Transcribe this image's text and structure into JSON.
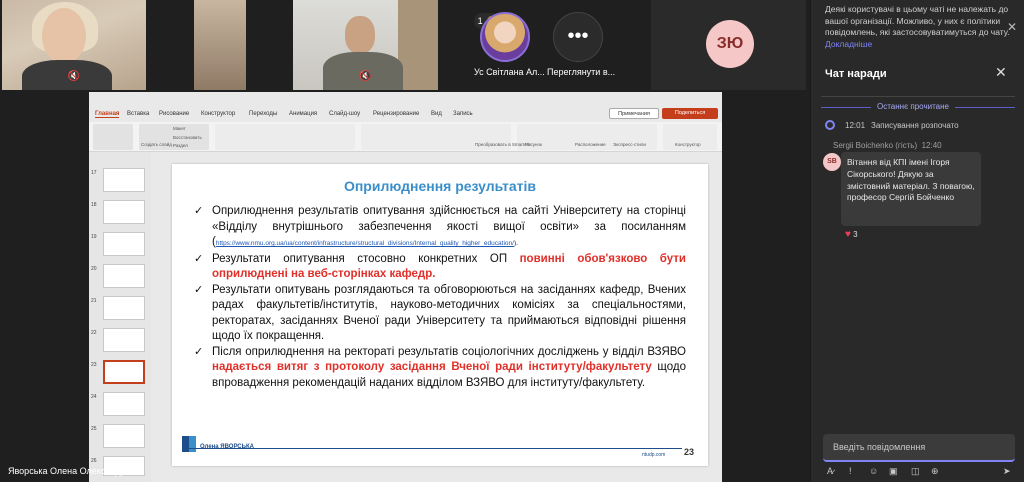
{
  "participants": [
    {
      "name": "",
      "tile": "video"
    },
    {
      "name": "",
      "tile": "video"
    },
    {
      "name": "",
      "tile": "video"
    },
    {
      "name": "Ус Світлана Ал...",
      "tile": "avatar",
      "hand_count": "1"
    },
    {
      "name": "Переглянути в...",
      "tile": "more"
    },
    {
      "name": "",
      "tile": "initials",
      "initials": "ЗЮ"
    }
  ],
  "presenter_name": "Яворська Олена Олександрівна",
  "ppt": {
    "menu": [
      "Главная",
      "Вставка",
      "Рисование",
      "Конструктор",
      "Переходы",
      "Анимация",
      "Слайд-шоу",
      "Рецензирование",
      "Вид",
      "Запись"
    ],
    "notes_button": "Примечания",
    "share_button": "Поделиться",
    "ribbon_labels": [
      "Создать слайд",
      "Макет",
      "Восстановить",
      "Раздел",
      "Преобразовать в SmartArt",
      "Рисунок",
      "Расположение",
      "Экспресс-стили",
      "Конструктор"
    ],
    "thumb_numbers": [
      "17",
      "18",
      "19",
      "20",
      "21",
      "22",
      "23",
      "24",
      "25",
      "26"
    ],
    "selected_thumb": "23"
  },
  "slide": {
    "title": "Оприлюднення результатів",
    "b1_text": "Оприлюднення результатів опитування здійснюється на сайті Університету на сторінці «Відділу внутрішнього забезпечення якості вищої освіти» за посиланням (",
    "b1_link": "https://www.nmu.org.ua/ua/content/infrastructure/structural_divisions/Internal_quality_higher_education/",
    "b1_end": ").",
    "b2_text": "Результати опитування стосовно конкретних ОП ",
    "b2_red": "повинні обов'язково бути оприлюднені на веб-сторінках кафедр.",
    "b3_text": "Результати опитувань розглядаються та обговорюються на засіданнях кафедр, Вчених радах факультетів/інститутів, науково-методичних комісіях за спеціальностями, ректоратах, засіданнях Вченої ради Університету та приймаються відповідні рішення щодо їх покращення.",
    "b4_text": "Після оприлюднення на ректораті результатів соціологічних досліджень у відділ ВЗЯВО ",
    "b4_red": "надається витяг з протоколу засідання Вченої ради інституту/факультету",
    "b4_end": " щодо впровадження рекомендацій наданих відділом ВЗЯВО для інституту/факультету.",
    "footer_name": "Олена ЯВОРСЬКА",
    "footer_site": "ntudp.com",
    "page_number": "23"
  },
  "chat": {
    "policy_text": "Деякі користувачі в цьому чаті не належать до вашої організації. Можливо, у них є політики повідомлень, які застосовуватимуться до чату. ",
    "policy_more": "Докладніше",
    "title": "Чат наради",
    "last_read": "Останнє прочитане",
    "system_time": "12:01",
    "system_text": "Записування розпочато",
    "sender": "Sergii Boichenko (гість)",
    "sender_time": "12:40",
    "sender_initials": "SB",
    "message": "Вітання від КПІ імені Ігоря Сікорського! Дякую за змістовний матеріал. З повагою, професор Сергій Бойченко",
    "reaction_count": "3",
    "compose_placeholder": "Введіть повідомлення"
  }
}
